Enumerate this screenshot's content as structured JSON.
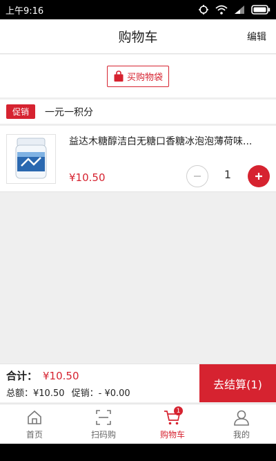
{
  "status_bar": {
    "time": "上午9:16"
  },
  "header": {
    "title": "购物车",
    "edit_label": "编辑"
  },
  "bag_button": {
    "label": "买购物袋"
  },
  "promo": {
    "badge": "促销",
    "text": "一元一积分"
  },
  "item": {
    "title": "益达木糖醇洁白无糖口香糖冰泡泡薄荷味...",
    "price": "¥10.50",
    "quantity": "1"
  },
  "checkout": {
    "total_label": "合计：",
    "total_amount": "¥10.50",
    "sum_text": "总额：¥10.50",
    "promo_text": "促销：- ¥0.00",
    "button_label": "去结算(1)"
  },
  "tabs": [
    {
      "label": "首页",
      "icon": "home-icon"
    },
    {
      "label": "扫码购",
      "icon": "scan-icon"
    },
    {
      "label": "购物车",
      "icon": "cart-icon",
      "badge": "1",
      "active": true
    },
    {
      "label": "我的",
      "icon": "user-icon"
    }
  ],
  "colors": {
    "accent": "#d62330"
  }
}
